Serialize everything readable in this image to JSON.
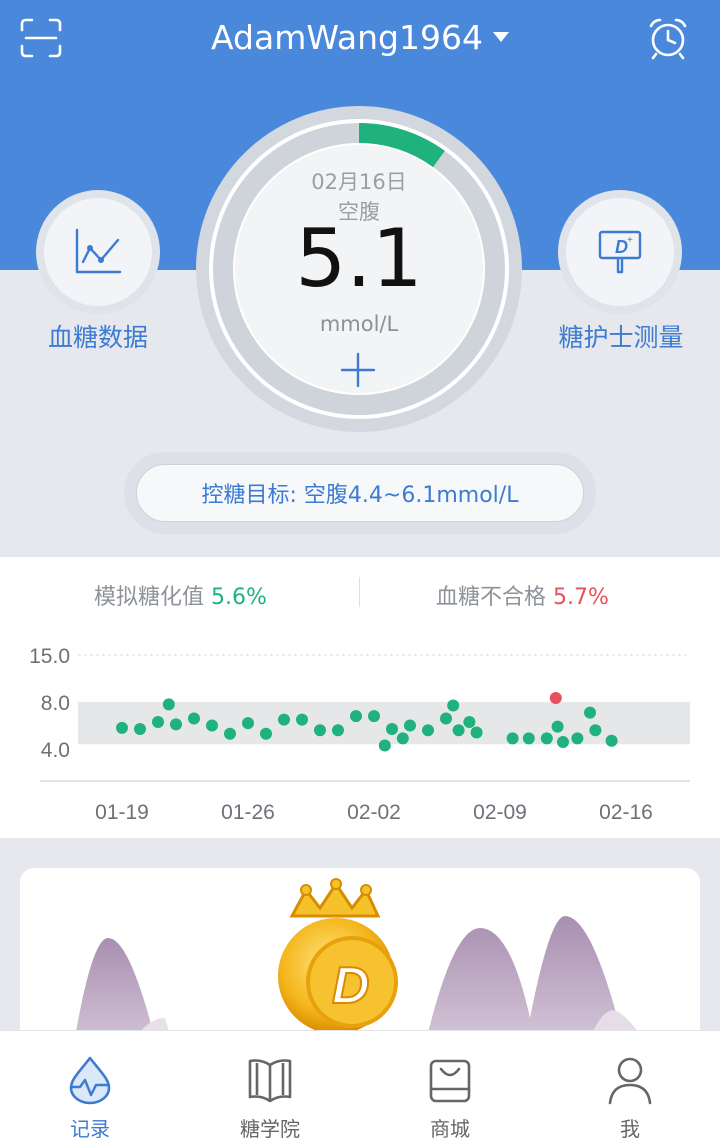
{
  "header": {
    "username": "AdamWang1964",
    "scan_icon": "scan-icon",
    "alarm_icon": "alarm-clock-icon",
    "bg_color": "#4a88dc"
  },
  "left_button": {
    "label": "血糖数据",
    "icon": "line-chart-icon"
  },
  "right_button": {
    "label": "糖护士测量",
    "icon": "meter-device-icon"
  },
  "reading": {
    "date": "02月16日",
    "period": "空腹",
    "value": "5.1",
    "unit": "mmol/L",
    "progress": 0.1
  },
  "target": {
    "text": "控糖目标: 空腹4.4~6.1mmol/L"
  },
  "stats": {
    "hba1c_label": "模拟糖化值",
    "hba1c_value": "5.6%",
    "unqualified_label": "血糖不合格",
    "unqualified_value": "5.7%"
  },
  "chart_data": {
    "type": "scatter",
    "title": "",
    "xlabel": "",
    "ylabel": "",
    "y_ticks": [
      "15.0",
      "8.0",
      "4.0"
    ],
    "x_ticks": [
      "01-19",
      "01-26",
      "02-02",
      "02-09",
      "02-16"
    ],
    "target_band": [
      4.4,
      8.0
    ],
    "colors": {
      "normal": "#1fb27c",
      "abnormal": "#e8505b",
      "band": "#e6e7e9"
    },
    "points": [
      {
        "day": 0,
        "y": 5.8
      },
      {
        "day": 1,
        "y": 5.7
      },
      {
        "day": 2,
        "y": 6.3
      },
      {
        "day": 2.6,
        "y": 7.8
      },
      {
        "day": 3,
        "y": 6.1
      },
      {
        "day": 4,
        "y": 6.6
      },
      {
        "day": 5,
        "y": 6.0
      },
      {
        "day": 6,
        "y": 5.3
      },
      {
        "day": 7,
        "y": 6.2
      },
      {
        "day": 8,
        "y": 5.3
      },
      {
        "day": 9,
        "y": 6.5
      },
      {
        "day": 10,
        "y": 6.5
      },
      {
        "day": 11,
        "y": 5.6
      },
      {
        "day": 12,
        "y": 5.6
      },
      {
        "day": 13,
        "y": 6.8
      },
      {
        "day": 14,
        "y": 6.8
      },
      {
        "day": 14.6,
        "y": 4.3
      },
      {
        "day": 15,
        "y": 5.7
      },
      {
        "day": 15.6,
        "y": 4.9
      },
      {
        "day": 16,
        "y": 6.0
      },
      {
        "day": 17,
        "y": 5.6
      },
      {
        "day": 18,
        "y": 6.6
      },
      {
        "day": 18.4,
        "y": 7.7
      },
      {
        "day": 18.7,
        "y": 5.6
      },
      {
        "day": 19.3,
        "y": 6.3
      },
      {
        "day": 19.7,
        "y": 5.4
      },
      {
        "day": 21.7,
        "y": 4.9
      },
      {
        "day": 22.6,
        "y": 4.9
      },
      {
        "day": 23.6,
        "y": 4.9
      },
      {
        "day": 24.1,
        "y": 8.6,
        "abnormal": true
      },
      {
        "day": 24.2,
        "y": 5.9
      },
      {
        "day": 24.5,
        "y": 4.6
      },
      {
        "day": 25.3,
        "y": 4.9
      },
      {
        "day": 26.0,
        "y": 7.1
      },
      {
        "day": 26.3,
        "y": 5.6
      },
      {
        "day": 27.2,
        "y": 4.7
      }
    ]
  },
  "promo": {
    "icon": "gold-coin-crown-icon"
  },
  "tabs": [
    {
      "label": "记录",
      "icon": "record-drop-icon",
      "active": true
    },
    {
      "label": "糖学院",
      "icon": "book-icon",
      "active": false
    },
    {
      "label": "商城",
      "icon": "shopping-bag-icon",
      "active": false
    },
    {
      "label": "我",
      "icon": "person-icon",
      "active": false
    }
  ]
}
